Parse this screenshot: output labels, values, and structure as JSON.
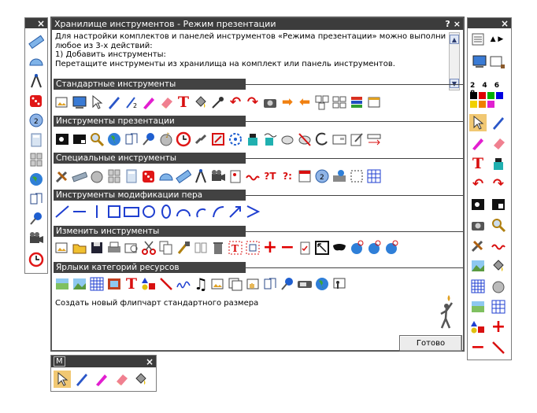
{
  "main": {
    "title": "Хранилище инструментов - Режим презентации",
    "help": "?",
    "close": "×",
    "intro": [
      "Для настройки комплектов и панелей инструментов «Режима презентации» можно выполнить",
      "любое из 3-х действий:",
      "1) Добавить инструменты:",
      "Перетащите инструменты из хранилища на комплект или панель инструментов."
    ],
    "sections": [
      "Стандартные инструменты",
      "Инструменты презентации",
      "Специальные инструменты",
      "Инструменты модификации пера",
      "Изменить инструменты",
      "Ярлыки категорий ресурсов"
    ],
    "status": "Создать новый флипчарт стандартного размера",
    "done_button": "Готово"
  },
  "left_palette": {
    "close": "×"
  },
  "right_palette": {
    "close": "×",
    "pen_widths": "2 4 6 8"
  },
  "small_palette": {
    "label": "M",
    "close": "×"
  },
  "colors": {
    "titlebar": "#3c3c3c",
    "selected": "#f1c873",
    "accent_red": "#e00000"
  }
}
